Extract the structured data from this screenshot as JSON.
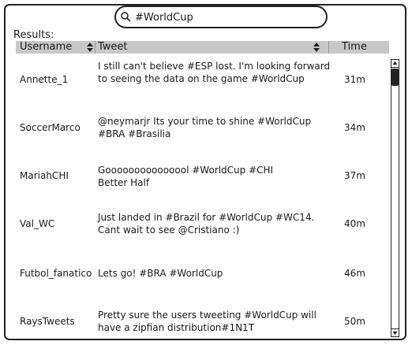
{
  "search": {
    "placeholder": "#WorldCup",
    "value": "#WorldCup"
  },
  "results_label": "Results:",
  "columns": {
    "username": "Username",
    "tweet": "Tweet",
    "time": "Time"
  },
  "rows": [
    {
      "username": "Annette_1",
      "tweet": "I  still can't believe #ESP lost. I'm looking forward to seeing the data  on the game #WorldCup",
      "time": "31m"
    },
    {
      "username": "SoccerMarco",
      "tweet": "@neymarjr Its your time to shine #WorldCup #BRA #Brasilia",
      "time": "34m"
    },
    {
      "username": "MariahCHI",
      "tweet": "Gooooooooooooool #WorldCup #CHI Better Half",
      "time": "37m"
    },
    {
      "username": "Val_WC",
      "tweet": "Just landed in #Brazil for #WorldCup #WC14. Cant wait  to see @Cristiano  :)",
      "time": "40m"
    },
    {
      "username": "Futbol_fanatico",
      "tweet": "Lets go! #BRA #WorldCup",
      "time": "46m"
    },
    {
      "username": "RaysTweets",
      "tweet": "Pretty sure the users tweeting #WorldCup will have a zipfian distribution#1N1T",
      "time": "50m"
    }
  ],
  "icons": {
    "search": "search-icon",
    "sort": "sort-arrows-icon",
    "scroll_up": "scroll-up-arrow-icon",
    "scroll_down": "scroll-down-arrow-icon"
  }
}
